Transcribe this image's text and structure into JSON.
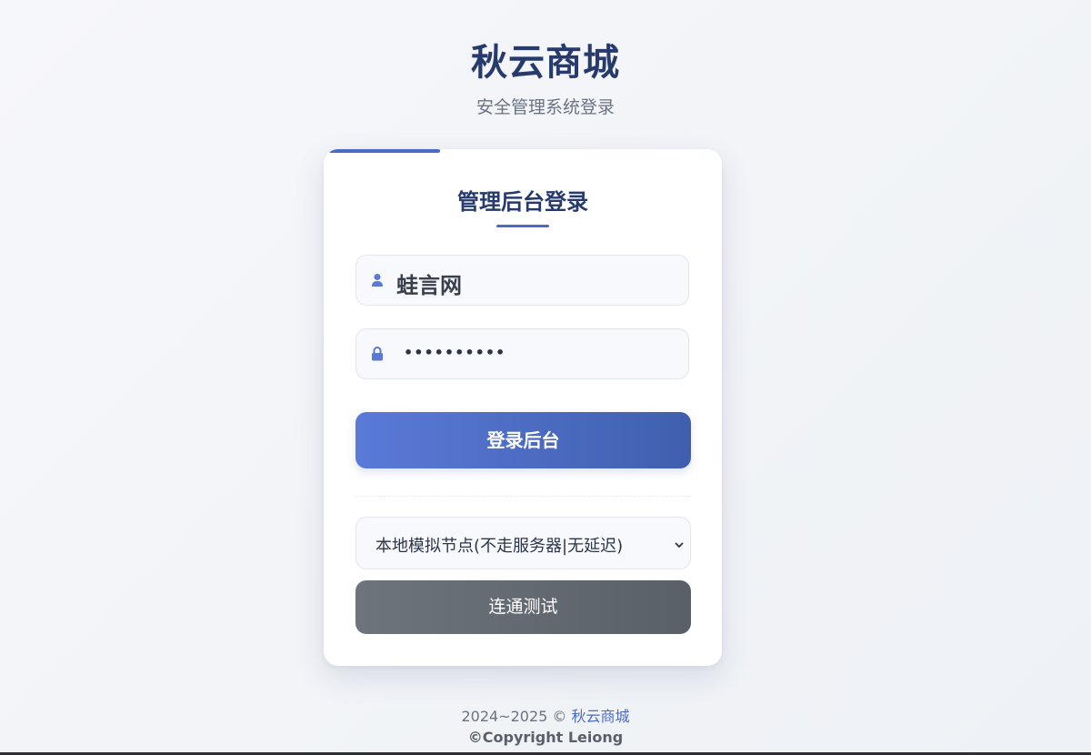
{
  "header": {
    "title": "秋云商城",
    "subtitle": "安全管理系统登录"
  },
  "login_card": {
    "title": "管理后台登录",
    "username": {
      "icon": "user-icon",
      "value": "蛙言网"
    },
    "password": {
      "icon": "lock-icon",
      "masked_value": "••••••••••"
    },
    "login_button": "登录后台",
    "node_select": {
      "selected": "本地模拟节点(不走服务器|无延迟)",
      "icon": "chevron-down-icon"
    },
    "test_button": "连通测试"
  },
  "footer": {
    "years": "2024~2025 © ",
    "brand_link": "秋云商城",
    "copyright": "©Copyright Leiong"
  },
  "colors": {
    "primary": "#4a6bc6",
    "title": "#263a6e",
    "test_button": "#646a72"
  }
}
